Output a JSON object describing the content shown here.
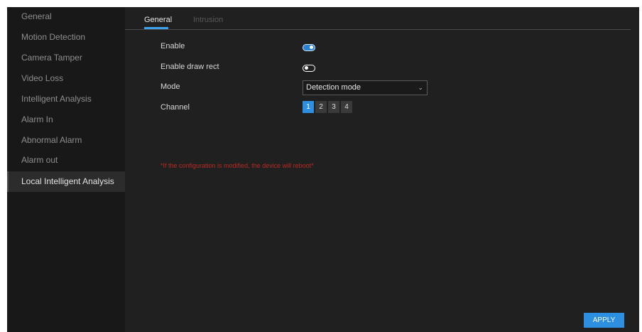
{
  "sidebar": {
    "items": [
      {
        "label": "General"
      },
      {
        "label": "Motion Detection"
      },
      {
        "label": "Camera Tamper"
      },
      {
        "label": "Video Loss"
      },
      {
        "label": "Intelligent Analysis"
      },
      {
        "label": "Alarm In"
      },
      {
        "label": "Abnormal Alarm"
      },
      {
        "label": "Alarm out"
      },
      {
        "label": "Local Intelligent Analysis",
        "active": true
      }
    ]
  },
  "tabs": [
    {
      "label": "General",
      "active": true
    },
    {
      "label": "Intrusion",
      "active": false
    }
  ],
  "form": {
    "enable": {
      "label": "Enable",
      "state": "on"
    },
    "enable_draw_rect": {
      "label": "Enable draw rect",
      "state": "off"
    },
    "mode": {
      "label": "Mode",
      "value": "Detection mode",
      "chevron": "⌄"
    },
    "channel": {
      "label": "Channel",
      "options": [
        "1",
        "2",
        "3",
        "4"
      ],
      "selected": "1"
    }
  },
  "warning": "*If the configuration is modified, the device will reboot*",
  "apply_label": "APPLY",
  "colors": {
    "accent": "#2e8fe0",
    "warning": "#b82a23",
    "background": "#202020",
    "sidebar": "#181818"
  },
  "icons": {
    "toggle_on": "toggle-on-icon",
    "toggle_off": "toggle-off-icon",
    "dropdown": "chevron-down-icon"
  }
}
